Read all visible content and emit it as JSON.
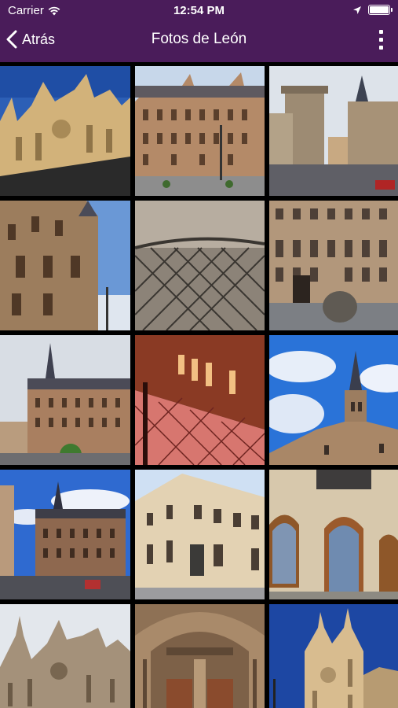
{
  "status": {
    "carrier": "Carrier",
    "time": "12:54 PM",
    "battery_level": 1.0
  },
  "navbar": {
    "back_label": "Atrás",
    "title": "Fotos de León",
    "bar_color": "#4a1c5a"
  },
  "photos": [
    {
      "subject": "León Cathedral facade, blue sky"
    },
    {
      "subject": "Casa Botines building with plaza"
    },
    {
      "subject": "Stone towers and street view"
    },
    {
      "subject": "Stone building with turret"
    },
    {
      "subject": "Metal grille sculpture close-up"
    },
    {
      "subject": "Casa Botines front facade"
    },
    {
      "subject": "Casa Botines spire, cloudy sky"
    },
    {
      "subject": "Red lit brick facade at night"
    },
    {
      "subject": "Spire against blue sky with clouds"
    },
    {
      "subject": "Casa Botines with blue sky and street"
    },
    {
      "subject": "Street corner building with balconies"
    },
    {
      "subject": "Arched windows on stone facade"
    },
    {
      "subject": "Cathedral silhouette, bright sky"
    },
    {
      "subject": "Cathedral portal with wooden doors"
    },
    {
      "subject": "Cathedral tower, deep blue sky"
    }
  ]
}
